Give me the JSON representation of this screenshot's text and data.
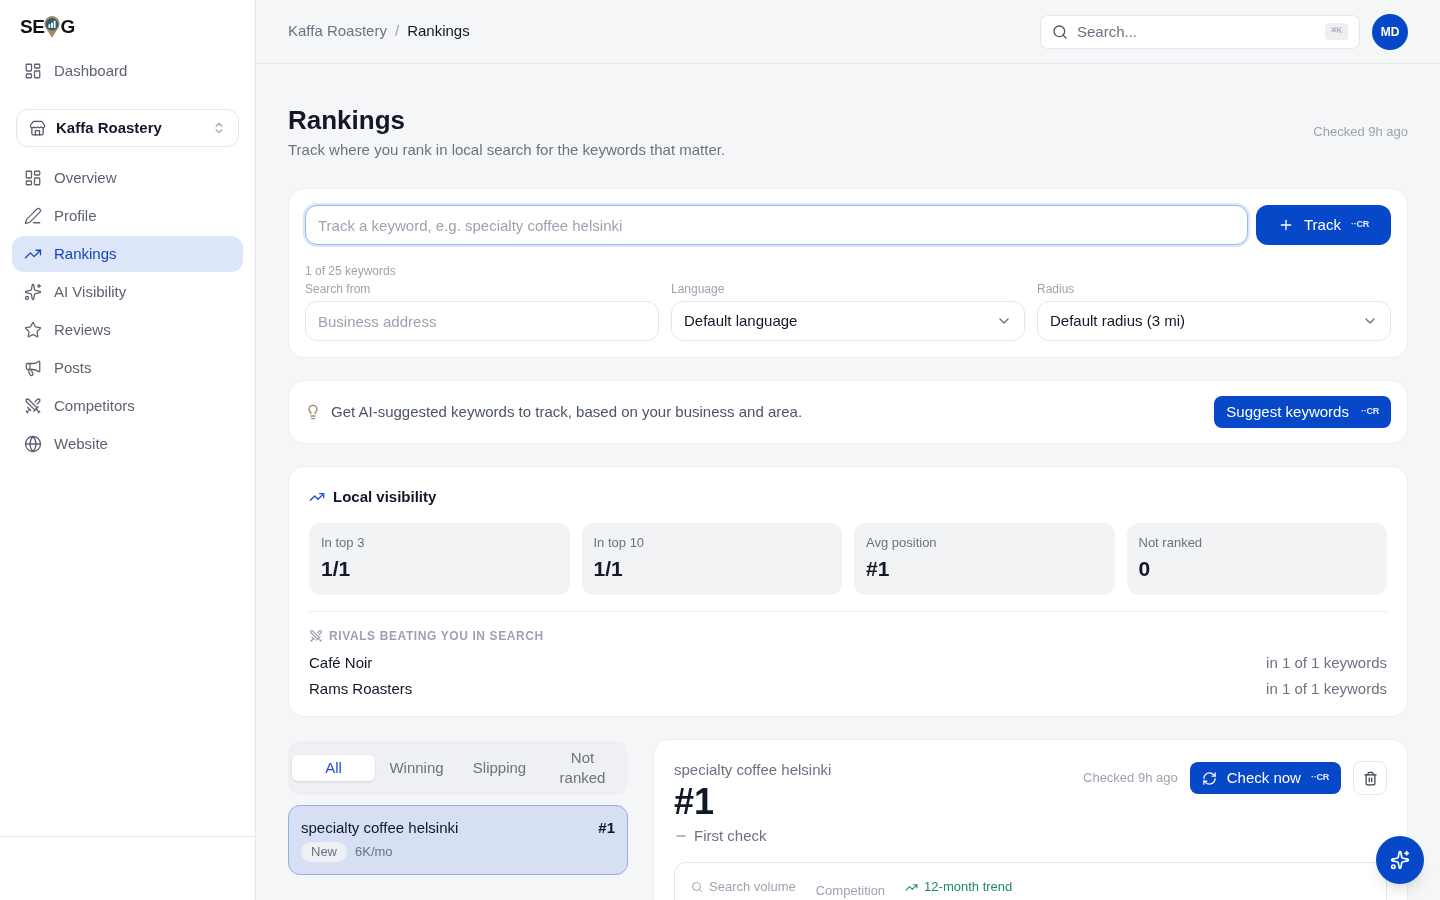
{
  "logo": {
    "lead": "SE",
    "tail": "G"
  },
  "sidebar": {
    "top_items": [
      {
        "label": "Dashboard",
        "selected": false
      }
    ],
    "business_switcher": {
      "name": "Kaffa Roastery"
    },
    "items": [
      {
        "label": "Overview",
        "selected": false
      },
      {
        "label": "Profile",
        "selected": false
      },
      {
        "label": "Rankings",
        "selected": true
      },
      {
        "label": "AI Visibility",
        "selected": false
      },
      {
        "label": "Reviews",
        "selected": false
      },
      {
        "label": "Posts",
        "selected": false
      },
      {
        "label": "Competitors",
        "selected": false
      },
      {
        "label": "Website",
        "selected": false
      }
    ]
  },
  "breadcrumb": {
    "parent": "Kaffa Roastery",
    "separator": "/",
    "current": "Rankings"
  },
  "search": {
    "placeholder": "Search...",
    "shortcut": "⌘K"
  },
  "avatar": {
    "initials": "MD"
  },
  "header": {
    "title": "Rankings",
    "subtitle": "Track where you rank in local search for the keywords that matter.",
    "checked": "Checked 9h ago"
  },
  "track_form": {
    "keyword_input": {
      "placeholder": "Track a keyword, e.g. specialty coffee helsinki",
      "focused": true
    },
    "track_button": {
      "label": "Track",
      "shortcut": "··CR"
    },
    "quota": "1 of 25 keywords",
    "fields": [
      {
        "label": "Search from",
        "kind": "input",
        "placeholder": "Business address"
      },
      {
        "label": "Language",
        "kind": "select",
        "value": "Default language"
      },
      {
        "label": "Radius",
        "kind": "select",
        "value": "Default radius (3 mi)"
      }
    ]
  },
  "suggest_banner": {
    "text": "Get AI-suggested keywords to track, based on your business and area.",
    "button": {
      "label": "Suggest keywords",
      "shortcut": "··CR"
    }
  },
  "local_visibility": {
    "title": "Local visibility",
    "stats": [
      {
        "label": "In top 3",
        "value": "1/1"
      },
      {
        "label": "In top 10",
        "value": "1/1"
      },
      {
        "label": "Avg position",
        "value": "#1"
      },
      {
        "label": "Not ranked",
        "value": "0"
      }
    ],
    "rivals_heading": "RIVALS BEATING YOU IN SEARCH",
    "rivals": [
      {
        "name": "Café Noir",
        "count": "in 1 of 1 keywords"
      },
      {
        "name": "Rams Roasters",
        "count": "in 1 of 1 keywords"
      }
    ]
  },
  "keyword_filters": [
    {
      "label": "All",
      "selected": true
    },
    {
      "label": "Winning",
      "selected": false
    },
    {
      "label": "Slipping",
      "selected": false
    },
    {
      "label": "Not ranked",
      "selected": false
    }
  ],
  "keywords": [
    {
      "keyword": "specialty coffee helsinki",
      "rank": "#1",
      "badge": "New",
      "volume": "6K/mo",
      "selected": true
    }
  ],
  "keyword_detail": {
    "keyword": "specialty coffee helsinki",
    "rank": "#1",
    "change": "First check",
    "checked": "Checked 9h ago",
    "check_button": {
      "label": "Check now",
      "shortcut": "··CR"
    },
    "metrics": [
      {
        "label": "Search volume",
        "kind": "search"
      },
      {
        "label": "Competition",
        "kind": "plain"
      },
      {
        "label": "12-month trend",
        "kind": "trend"
      }
    ]
  }
}
